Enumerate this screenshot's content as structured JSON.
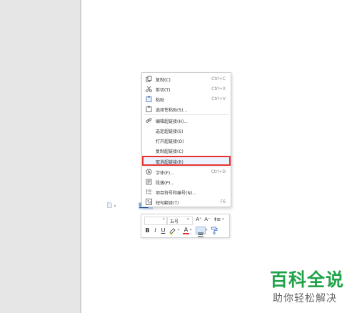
{
  "context_menu": {
    "items": [
      {
        "label": "复制(C)",
        "shortcut": "Ctrl+C",
        "icon": "copy-icon"
      },
      {
        "label": "剪切(T)",
        "shortcut": "Ctrl+X",
        "icon": "scissors-icon"
      },
      {
        "label": "粘贴",
        "shortcut": "Ctrl+V",
        "icon": "paste-icon"
      },
      {
        "label": "选择性粘贴(S)...",
        "shortcut": "",
        "icon": "paste-special-icon"
      },
      {
        "label": "编辑超链接(H)...",
        "shortcut": "",
        "icon": "hyperlink-icon"
      },
      {
        "label": "选定超链接(S)",
        "shortcut": "",
        "icon": ""
      },
      {
        "label": "打开超链接(O)",
        "shortcut": "",
        "icon": ""
      },
      {
        "label": "复制超链接(C)",
        "shortcut": "",
        "icon": ""
      },
      {
        "label": "取消超链接(R)",
        "shortcut": "",
        "icon": ""
      },
      {
        "label": "字体(F)...",
        "shortcut": "Ctrl+D",
        "icon": "font-icon"
      },
      {
        "label": "段落(P)...",
        "shortcut": "",
        "icon": "paragraph-icon"
      },
      {
        "label": "项目符号和编号(N)...",
        "shortcut": "",
        "icon": "bullets-icon"
      },
      {
        "label": "短句翻译(T)",
        "shortcut": "F6",
        "icon": "translate-icon"
      }
    ]
  },
  "highlight_color": "#e8312f",
  "mini_toolbar": {
    "font_size": "五号",
    "bold": "B",
    "italic": "I",
    "underline": "U",
    "font_color": "A",
    "grow_font": "A⁺",
    "shrink_font": "A⁻",
    "line_spacing": "‡≡"
  },
  "watermark": {
    "title": "百科全说",
    "subtitle": "助你轻松解决",
    "color": "#22a34a"
  }
}
